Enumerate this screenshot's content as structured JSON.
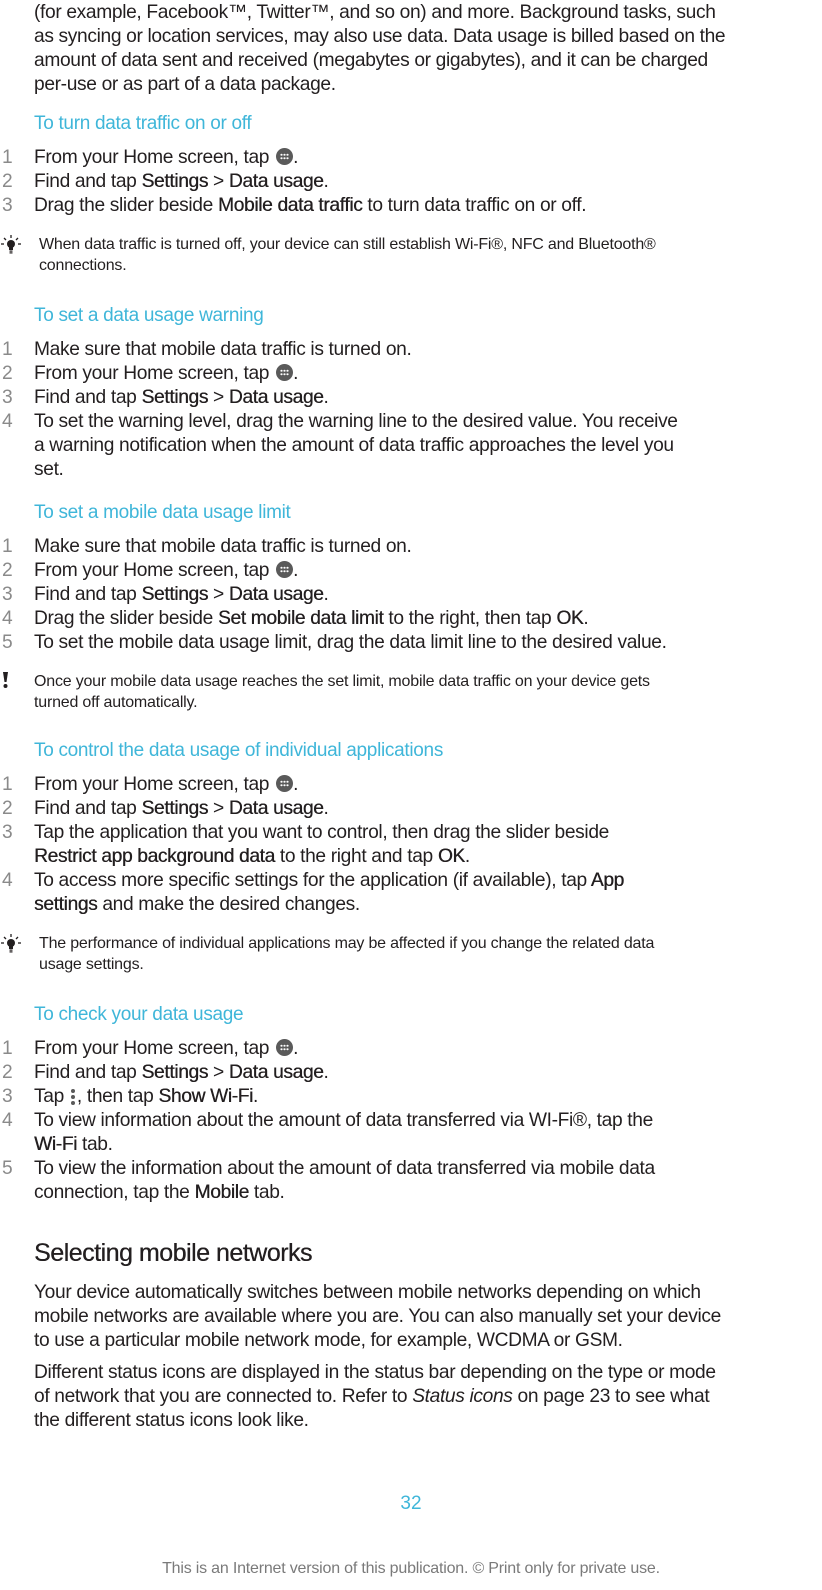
{
  "intro": {
    "lines": [
      "(for example, Facebook™, Twitter™, and so on) and more. Background tasks, such",
      "as syncing or location services, may also use data. Data usage is billed based on the",
      "amount of data sent and received (megabytes or gigabytes), and it can be charged",
      "per-use or as part of a data package."
    ]
  },
  "common": {
    "from_home": "From your Home screen, tap",
    "period": ".",
    "find_tap": "Find and tap",
    "settings": "Settings",
    "sep": ">",
    "data_usage": "Data usage",
    "make_sure": "Make sure that mobile data traffic is turned on.",
    "apps_icon": "apps-icon",
    "tip_icon": "lightbulb-icon",
    "warn_icon": "exclamation-icon",
    "menu_icon": "overflow-menu-icon"
  },
  "section1": {
    "title": "To turn data traffic on or off",
    "step3": {
      "pre": "Drag the slider beside",
      "bold": "Mobile data traffic",
      "post": "to turn data traffic on or off."
    },
    "tip": [
      "When data traffic is turned off, your device can still establish Wi-Fi®, NFC and Bluetooth®",
      "connections."
    ]
  },
  "section2": {
    "title": "To set a data usage warning",
    "step4": [
      "To set the warning level, drag the warning line to the desired value. You receive",
      "a warning notification when the amount of data traffic approaches the level you",
      "set."
    ]
  },
  "section3": {
    "title": "To set a mobile data usage limit",
    "step4": {
      "pre": "Drag the slider beside",
      "bold": "Set mobile data limit",
      "mid": "to the right, then tap",
      "ok": "OK",
      "post": "."
    },
    "step5": "To set the mobile data usage limit, drag the data limit line to the desired value.",
    "warning": [
      "Once your mobile data usage reaches the set limit, mobile data traffic on your device gets",
      "turned off automatically."
    ]
  },
  "section4": {
    "title": "To control the data usage of individual applications",
    "step3": {
      "line1": "Tap the application that you want to control, then drag the slider beside",
      "bold": "Restrict app background data",
      "mid": "to the right and tap",
      "ok": "OK",
      "post": "."
    },
    "step4": {
      "pre": "To access more specific settings for the application (if available), tap",
      "bold1": "App",
      "bold2": "settings",
      "post": "and make the desired changes."
    },
    "tip": [
      "The performance of individual applications may be affected if you change the related data",
      "usage settings."
    ]
  },
  "section5": {
    "title": "To check your data usage",
    "step3": {
      "pre": "Tap",
      "mid": ", then tap",
      "bold": "Show Wi-Fi",
      "post": "."
    },
    "step4": {
      "line1": "To view information about the amount of data transferred via WI-Fi®, tap the",
      "bold": "Wi-Fi",
      "post": "tab."
    },
    "step5": {
      "line1": "To view the information about the amount of data transferred via mobile data",
      "pre": "connection, tap the",
      "bold": "Mobile",
      "post": "tab."
    }
  },
  "networks": {
    "title": "Selecting mobile networks",
    "para1": [
      "Your device automatically switches between mobile networks depending on which",
      "mobile networks are available where you are. You can also manually set your device",
      "to use a particular mobile network mode, for example, WCDMA or GSM."
    ],
    "para2": {
      "line1": "Different status icons are displayed in the status bar depending on the type or mode",
      "pre": "of network that you are connected to. Refer to",
      "link": "Status icons",
      "post": "on page 23 to see what",
      "line3": "the different status icons look like."
    }
  },
  "step_numbers": [
    "1",
    "2",
    "3",
    "4",
    "5"
  ],
  "page_number": "32",
  "footer": "This is an Internet version of this publication. © Print only for private use.",
  "colors": {
    "accent": "#3fb6d9",
    "text": "#231f20",
    "step_number": "#8a8a8a",
    "footer": "#7a7a7a"
  }
}
